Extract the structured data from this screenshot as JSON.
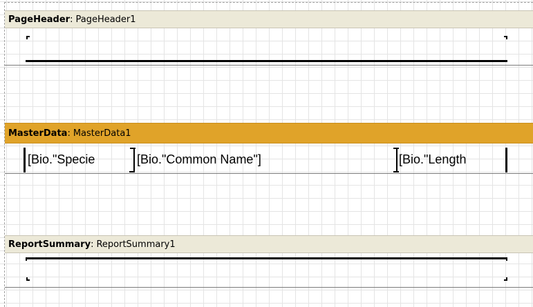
{
  "designer": {
    "bands": {
      "page_header": {
        "type": "PageHeader",
        "separator": ":",
        "name": "PageHeader1"
      },
      "master_data": {
        "type": "MasterData",
        "separator": ":",
        "name": "MasterData1"
      },
      "report_summary": {
        "type": "ReportSummary",
        "separator": ":",
        "name": "ReportSummary1"
      }
    },
    "fields": [
      {
        "expression": "[Bio.\"Specie"
      },
      {
        "expression": "[Bio.\"Common Name\"]"
      },
      {
        "expression": "[Bio.\"Length"
      }
    ]
  },
  "colors": {
    "band_header": "#ece9d8",
    "master_data_header": "#e0a329",
    "grid": "#e4e4e4"
  }
}
